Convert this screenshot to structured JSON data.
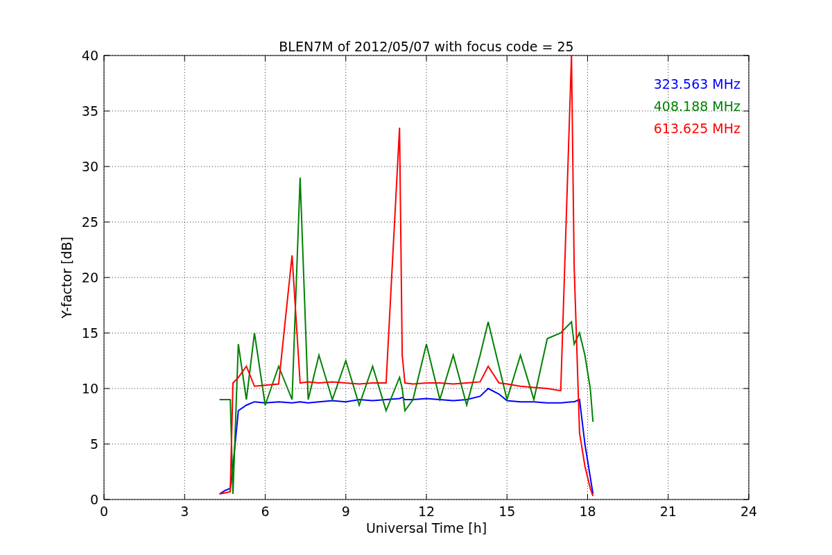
{
  "figure": {
    "chart_data": {
      "type": "line",
      "title": "BLEN7M of 2012/05/07 with focus code = 25",
      "xlabel": "Universal Time [h]",
      "ylabel": "Y-factor [dB]",
      "x": [
        4.3,
        4.5,
        4.7,
        4.8,
        5.0,
        5.3,
        5.6,
        6.0,
        6.5,
        7.0,
        7.3,
        7.6,
        8.0,
        8.5,
        9.0,
        9.5,
        10.0,
        10.5,
        11.0,
        11.1,
        11.2,
        11.5,
        12.0,
        12.5,
        13.0,
        13.5,
        14.0,
        14.3,
        14.7,
        15.0,
        15.5,
        16.0,
        16.5,
        17.0,
        17.4,
        17.5,
        17.7,
        17.9,
        18.1,
        18.2
      ],
      "series": [
        {
          "name": "323.563 MHz",
          "color": "#0000ff",
          "values": [
            0.5,
            0.8,
            1,
            3,
            8,
            8.5,
            8.8,
            8.7,
            8.8,
            8.7,
            8.8,
            8.7,
            8.8,
            8.9,
            8.8,
            9,
            8.9,
            9,
            9.1,
            9.2,
            9.0,
            9,
            9.1,
            9,
            8.9,
            9,
            9.3,
            10,
            9.5,
            8.9,
            8.8,
            8.8,
            8.7,
            8.7,
            8.8,
            8.8,
            9,
            5,
            2,
            0.5
          ]
        },
        {
          "name": "408.188 MHz",
          "color": "#008000",
          "values": [
            9,
            9,
            9,
            0.5,
            14,
            9,
            15,
            8.5,
            12,
            9,
            29,
            9,
            13,
            9,
            12.5,
            8.5,
            12,
            8,
            11,
            10,
            8,
            9,
            14,
            9,
            13,
            8.5,
            13,
            16,
            12,
            9,
            13,
            9,
            14.5,
            15,
            16,
            14,
            15,
            13,
            10,
            7
          ]
        },
        {
          "name": "613.625 MHz",
          "color": "#ff0000",
          "values": [
            0.5,
            0.6,
            0.7,
            10.5,
            11,
            12,
            10.2,
            10.3,
            10.4,
            22,
            10.5,
            10.6,
            10.5,
            10.6,
            10.5,
            10.4,
            10.5,
            10.5,
            33.5,
            13,
            10.5,
            10.4,
            10.5,
            10.5,
            10.4,
            10.5,
            10.6,
            12,
            10.5,
            10.4,
            10.2,
            10.1,
            10,
            9.8,
            40,
            21,
            6,
            3,
            1,
            0.3
          ]
        }
      ],
      "xlim": [
        0,
        24
      ],
      "ylim": [
        0,
        40
      ],
      "xticks": [
        0,
        3,
        6,
        9,
        12,
        15,
        18,
        21,
        24
      ],
      "yticks": [
        0,
        5,
        10,
        15,
        20,
        25,
        30,
        35,
        40
      ],
      "grid": true
    }
  }
}
